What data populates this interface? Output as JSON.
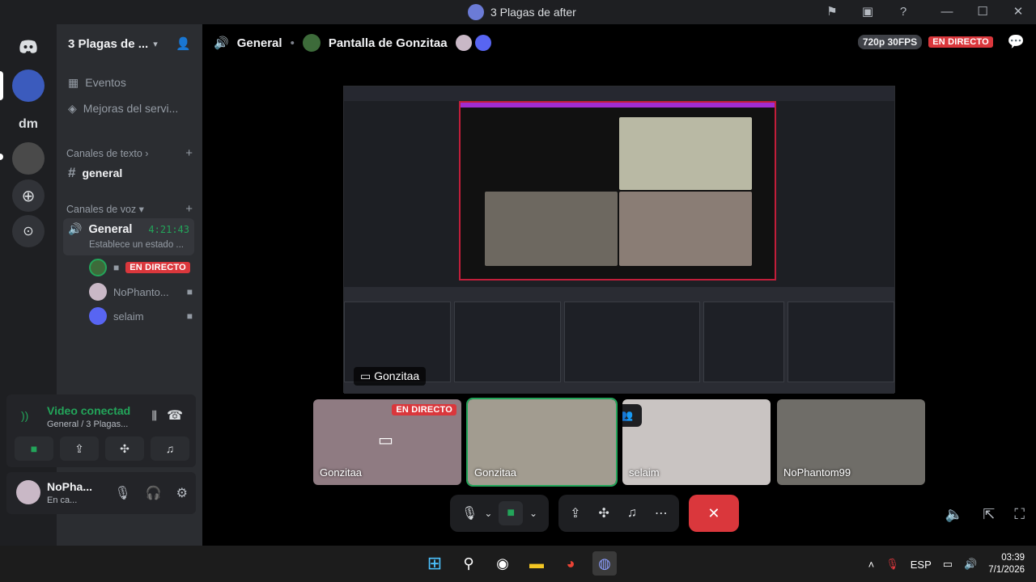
{
  "window": {
    "title": "3 Plagas de after"
  },
  "server": {
    "name": "3 Plagas de ...",
    "items": [
      "Eventos",
      "Mejoras del servi..."
    ],
    "text_category": "Canales de texto",
    "text_channel": "general",
    "voice_category": "Canales de voz",
    "voice_channel": {
      "name": "General",
      "timer": "4:21:43",
      "status": "Establece un estado ...",
      "members": [
        {
          "name": "",
          "live": "EN DIRECTO"
        },
        {
          "name": "NoPhanto..."
        },
        {
          "name": "selaim"
        }
      ]
    }
  },
  "rail": {
    "dm_label": "dm"
  },
  "voice_panel": {
    "title": "Video conectad",
    "subtitle": "General / 3 Plagas..."
  },
  "user_panel": {
    "name": "NoPha...",
    "status": "En ca..."
  },
  "stage": {
    "channel": "General",
    "screen_share": "Pantalla de Gonzitaa",
    "quality": "720p 30FPS",
    "live_badge": "EN DIRECTO",
    "stream_label": "Gonzitaa"
  },
  "participants": [
    {
      "name": "Gonzitaa",
      "live": "EN DIRECTO"
    },
    {
      "name": "Gonzitaa"
    },
    {
      "name": "selaim"
    },
    {
      "name": "NoPhantom99"
    }
  ],
  "taskbar": {
    "lang": "ESP",
    "time": "03:39",
    "date": "7/1/2026"
  },
  "colors": {
    "accent": "#5865f2",
    "live": "#da373c",
    "online": "#23a55a"
  }
}
